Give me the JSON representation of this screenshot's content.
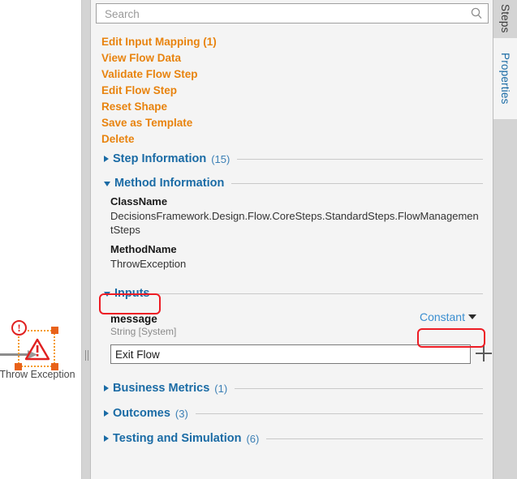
{
  "canvas": {
    "node": {
      "label": "Throw Exception",
      "error_badge_icon": "exclamation-circle-icon",
      "shape_icon": "warning-triangle-icon",
      "badge_glyph": "!",
      "triangle_glyph": "!",
      "selected": true,
      "selection_color": "#F59A23",
      "handle_color": "#E8621A",
      "error_color": "#E02020"
    },
    "incoming_connector_icon": "arrow-right-icon"
  },
  "splitter": {
    "grip_icon": "vertical-grip-icon"
  },
  "panel": {
    "search": {
      "placeholder": "Search",
      "value": "",
      "icon": "search-icon"
    },
    "action_links": [
      {
        "label": "Edit Input Mapping (1)"
      },
      {
        "label": "View Flow Data"
      },
      {
        "label": "Validate Flow Step"
      },
      {
        "label": "Edit Flow Step"
      },
      {
        "label": "Reset Shape"
      },
      {
        "label": "Save as Template"
      },
      {
        "label": "Delete"
      }
    ],
    "sections": {
      "step_information": {
        "title": "Step Information",
        "count": "(15)",
        "expanded": false
      },
      "method_information": {
        "title": "Method Information",
        "count": "",
        "expanded": true,
        "fields": [
          {
            "key": "ClassName",
            "value": "DecisionsFramework.Design.Flow.CoreSteps.StandardSteps.FlowManagementSteps"
          },
          {
            "key": "MethodName",
            "value": "ThrowException"
          }
        ]
      },
      "inputs": {
        "title": "Inputs",
        "count": "",
        "expanded": true,
        "field": {
          "name": "message",
          "type": "String [System]",
          "mapping_mode": "Constant",
          "value": "Exit Flow",
          "add_icon": "plus-icon"
        }
      },
      "business_metrics": {
        "title": "Business Metrics",
        "count": "(1)",
        "expanded": false
      },
      "outcomes": {
        "title": "Outcomes",
        "count": "(3)",
        "expanded": false
      },
      "testing_and_simulation": {
        "title": "Testing and Simulation",
        "count": "(6)",
        "expanded": false
      }
    }
  },
  "right_tabs": [
    {
      "label": "Steps",
      "active": false
    },
    {
      "label": "Properties",
      "active": true
    }
  ],
  "annotations": {
    "highlight_color": "#ED1C24",
    "boxes": [
      {
        "target": "inputs-section-header"
      },
      {
        "target": "constant-dropdown"
      }
    ]
  },
  "colors": {
    "link_orange": "#E8830E",
    "section_blue": "#1A6BA5",
    "dropdown_blue": "#3A8ED0",
    "panel_bg": "#F4F4F4"
  }
}
